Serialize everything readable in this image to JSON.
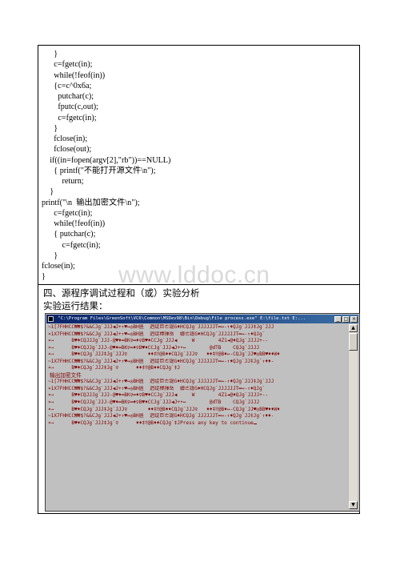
{
  "code_lines": [
    "      }",
    "      c=fgetc(in);",
    "      while(!feof(in))",
    "      {c=c^0x6a;",
    "        putchar(c);",
    "        fputc(c,out);",
    "        c=fgetc(in);",
    "      }",
    "      fclose(in);",
    "      fclose(out);",
    "    if((in=fopen(argv[2],\"rb\"))==NULL)",
    "      { printf(\"不能打开源文件\\n\");",
    "          return;",
    "    }",
    "printf(\"\\n  输出加密文件\\n\");",
    "      c=fgetc(in);",
    "      while(!feof(in))",
    "      { putchar(c);",
    "          c=fgetc(in);",
    "      }",
    "fclose(in);",
    "}"
  ],
  "watermark": "www.lddoc.cn",
  "section": {
    "heading": "四、源程序调试过程和（或）实验分析",
    "subheading": "实验运行结果："
  },
  "console": {
    "title": "\"C:\\Program Files\\GreenSoft\\VC6\\Common\\MSDev98\\Bin\\Debug\\File process.exe\" E:\\file.txt E:...",
    "minimize_symbol": "_",
    "maximize_symbol": "□",
    "close_symbol": "×",
    "scroll_up_symbol": "▲",
    "scroll_down_symbol": "▼",
    "output_color": "#800000",
    "lines": [
      "~1[7FHHCC₩₩$?&&CJg`JJJ◀J+↑♥↔◎BH匮  迥绽巨ㄜ譿G♦HCQJg`JJJJJJT═↔-↑♦QJg`JJJ‡Jg`JJJ",
      "¤1X7FHHCC₩₩$?&&CJg`JJJ◀J+↑♥↔◎BH匮  迥绽棒揮岳  嬶ㄜ譿G♦HCQJg`JJJJJJT═↔-↑♦QJg`",
      "¤→      B♥♦CQJJJg`JJJ-@♥♦═BK♀═♦♀B♥♦CCJg`JJJ◀     W        4Z1◄@♦QJg`JJJJ+--",
      "¤→      B♥♦CQJJg`JJJ-@♥♦═BK♀═♦♀B♥♦CCJg`JJJ◀J+•↔        @dTB    CQJg`JJJJ",
      "¤→      B♥♦CQJg`JJJ‡Jg`JJJ♀       ♦♦‡‼@B♦♦CQJg`JJJ♀   ♦♦‡‼@B♦↔-CQJg`JJ♥◎BB♥♦♦W♦",
      "~1X7FHHCC₩₩$?&&CJg`JJJ◀J+↑♥↔◎BH匮  迥绽巨ㄜ譿G♦HCQJg`JJJJJJT═↔-↑♦QJg`JJ‡Jg`↑♦♦-",
      "¤→      B♥♦CQJg`JJJ‡Jg`♀      ♦♦‡‼@B♦♦CQJg`‡J",
      " 输出加密文件",
      "~1[7FHHCC₩₩$?&&CJg`JJJ◀J+↑♥↔◎BH匮  迥绽巨ㄜ譿G♦HCQJg`JJJJJJT═↔-↑♦QJg`JJJ‡Jg`JJJ",
      "¤1X7FHHCC₩₩$?&&CJg`JJJ◀J+↑♥↔◎BH匮  迥绽棒揮岳  嬶ㄜ譿G♦HCQJg`JJJJJJT═↔-↑♦QJg`",
      "¤→      B♥♦CQJJJg`JJJ-@♥♦═BK♀═♦♀B♥♦CCJg`JJJ◀     W        4Z1◄@♦QJg`JJJJ+--",
      "¤→      B♥♦CQJJg`JJJ-@♥♦═BK♀═♦♀B♥♦CCJg`JJJ◀J+•↔        @dTB    CQJg`JJJJ",
      "¤→      B♥♦CQJg`JJJ‡Jg`JJJ♀       ♦♦‡‼@B♦♦CQJg`JJJ♀   ♦♦‡‼@B♦↔-CQJg`JJ♥◎BB♥♦♦W♦",
      "~1X7FHHCC₩₩$?&&CJg`JJJ◀J+↑♥↔◎BH匮  迥绽巨ㄜ譿G♦HCQJg`JJJJJJT═↔-↑♦QJg`JJ‡Jg`↑♦♦-",
      "¤→      B♥♦CQJg`JJJ‡Jg`♀      ♦♦‡‼@B♦♦CQJg`‡JPress any key to continue"
    ]
  }
}
